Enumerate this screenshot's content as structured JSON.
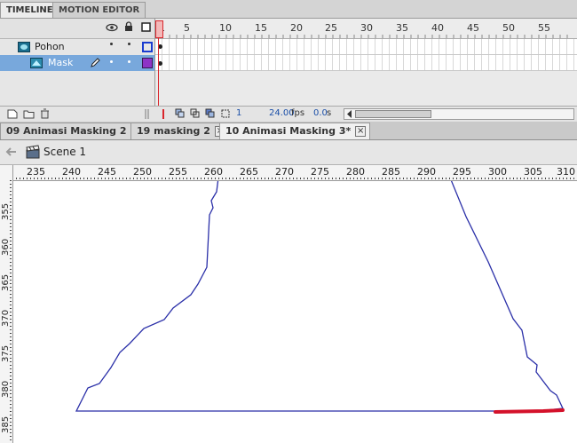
{
  "panel_tabs": [
    "TIMELINE",
    "MOTION EDITOR"
  ],
  "layers": [
    {
      "name": "Pohon",
      "icon": "layer-mask-icon"
    },
    {
      "name": "Mask",
      "icon": "layer-masked-icon"
    }
  ],
  "frame_numbers": [
    "1",
    "5",
    "10",
    "15",
    "20",
    "25",
    "30",
    "35",
    "40",
    "45",
    "50",
    "55"
  ],
  "status": {
    "frame": "1",
    "fps": "24.00",
    "fps_unit": "fps",
    "time": "0.0",
    "time_unit": "s"
  },
  "doc_tabs": [
    {
      "label": "09 Animasi Masking 2"
    },
    {
      "label": "19 masking 2"
    },
    {
      "label": "10 Animasi Masking 3*"
    }
  ],
  "scene": {
    "label": "Scene 1"
  },
  "h_ruler": [
    "235",
    "240",
    "245",
    "250",
    "255",
    "260",
    "265",
    "270",
    "275",
    "280",
    "285",
    "290",
    "295",
    "300",
    "305",
    "310"
  ],
  "v_ruler": [
    "355",
    "360",
    "365",
    "370",
    "375",
    "380",
    "385"
  ],
  "colors": {
    "outline": "#2a2fa8",
    "highlight": "#d4112a",
    "playhead": "#d9262c",
    "selected_layer": "#78a8dc"
  }
}
